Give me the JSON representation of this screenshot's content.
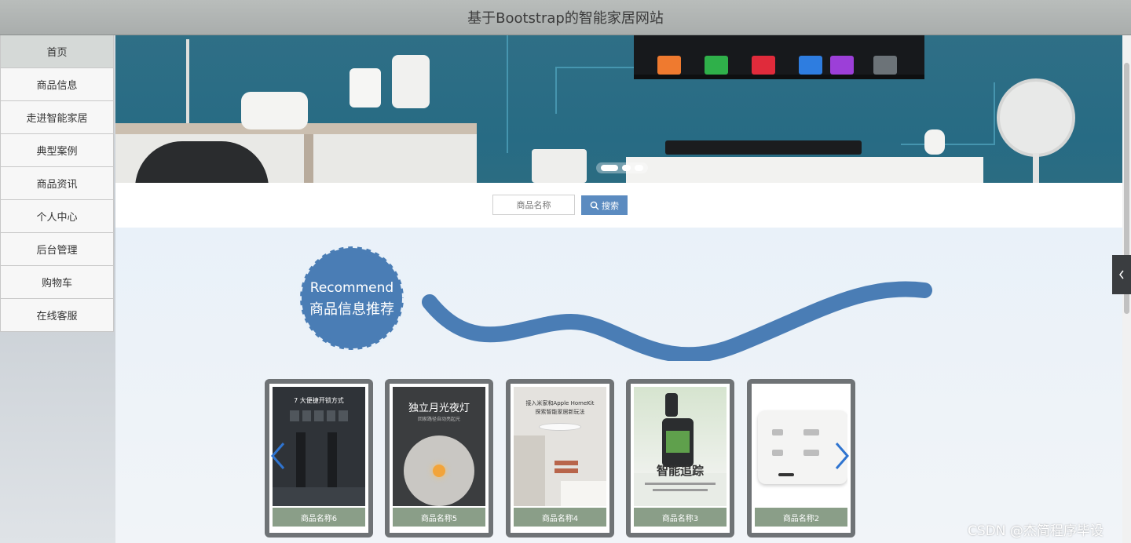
{
  "header": {
    "title": "基于Bootstrap的智能家居网站"
  },
  "sidebar": {
    "items": [
      {
        "label": "首页",
        "active": true
      },
      {
        "label": "商品信息"
      },
      {
        "label": "走进智能家居"
      },
      {
        "label": "典型案例"
      },
      {
        "label": "商品资讯"
      },
      {
        "label": "个人中心"
      },
      {
        "label": "后台管理"
      },
      {
        "label": "购物车"
      },
      {
        "label": "在线客服"
      }
    ]
  },
  "search": {
    "placeholder": "商品名称",
    "button_label": "搜索",
    "button_icon": "search-icon"
  },
  "recommend": {
    "title_en": "Recommend",
    "title_cn": "商品信息推荐",
    "accent": "#4a7db5"
  },
  "products": [
    {
      "name": "商品名称6",
      "image_text": "7 大便捷开锁方式"
    },
    {
      "name": "商品名称5",
      "image_text": "独立月光夜灯",
      "image_subtext": "回家路径自动亮起光"
    },
    {
      "name": "商品名称4",
      "image_text": "接入米家和Apple HomeKit",
      "image_subtext": "探索智能家居新玩法"
    },
    {
      "name": "商品名称3",
      "image_text": "智能追踪"
    },
    {
      "name": "商品名称2"
    }
  ],
  "watermark": "CSDN @杰简程序毕设"
}
